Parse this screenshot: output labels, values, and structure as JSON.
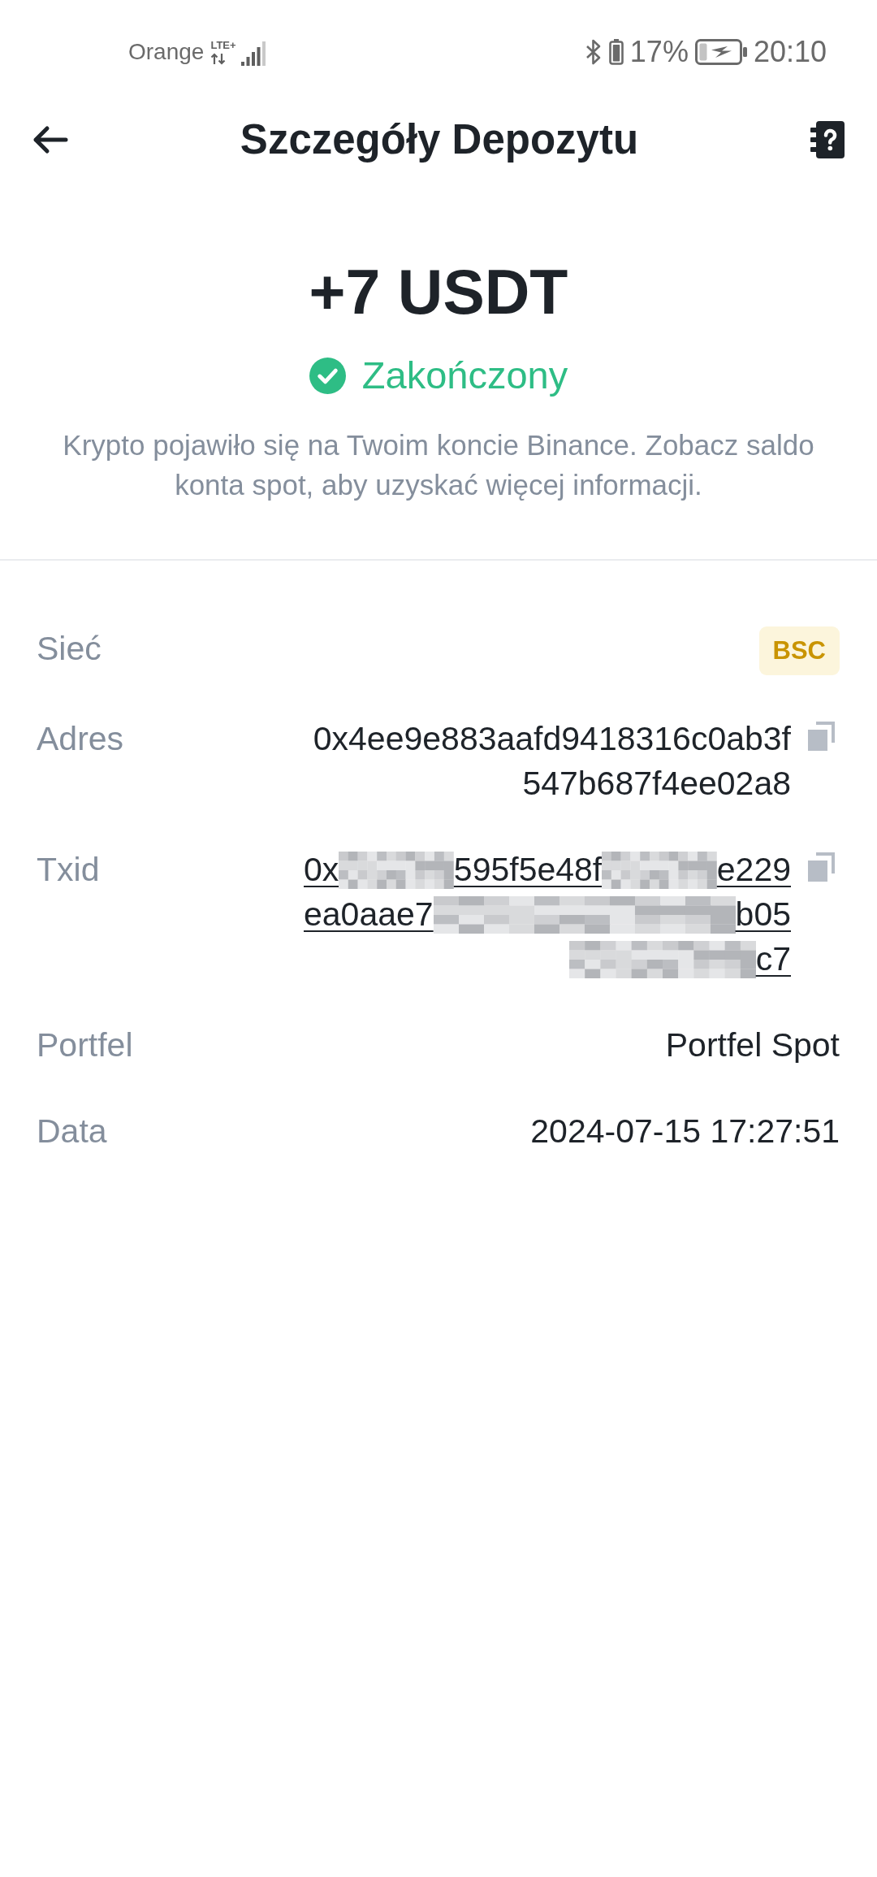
{
  "status_bar": {
    "carrier": "Orange",
    "network_type": "LTE+",
    "battery_percent": "17%",
    "time": "20:10"
  },
  "header": {
    "title": "Szczegóły Depozytu"
  },
  "summary": {
    "amount": "+7 USDT",
    "status": "Zakończony",
    "message": "Krypto pojawiło się na Twoim koncie Binance. Zobacz saldo konta spot, aby uzyskać więcej informacji."
  },
  "details": [
    {
      "kind": "badge",
      "label": "Sieć",
      "value": "BSC"
    },
    {
      "kind": "copyable",
      "label": "Adres",
      "value": "0x4ee9e883aafd9418316c0ab3f547b687f4ee02a8"
    },
    {
      "kind": "redacted_link",
      "label": "Txid",
      "lines": [
        [
          {
            "kind": "text",
            "text": "0x"
          },
          {
            "kind": "redacted"
          },
          {
            "kind": "text",
            "text": "595f5e48f"
          },
          {
            "kind": "redacted"
          },
          {
            "kind": "text",
            "text": "e229"
          }
        ],
        [
          {
            "kind": "text",
            "text": "ea0aae7"
          },
          {
            "kind": "redacted"
          },
          {
            "kind": "text",
            "text": "b05"
          }
        ],
        [
          {
            "kind": "redacted"
          },
          {
            "kind": "text",
            "text": "c7"
          }
        ]
      ]
    },
    {
      "kind": "text",
      "label": "Portfel",
      "value": "Portfel Spot"
    },
    {
      "kind": "text",
      "label": "Data",
      "value": "2024-07-15 17:27:51"
    }
  ]
}
